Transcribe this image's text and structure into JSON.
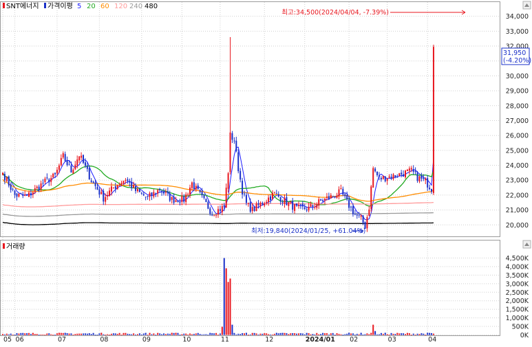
{
  "legend": {
    "title": "SNT에너지",
    "ma_label": "가격이평",
    "periods": [
      {
        "label": "5",
        "color": "#1a1aff"
      },
      {
        "label": "20",
        "color": "#22aa22"
      },
      {
        "label": "60",
        "color": "#ff8c00"
      },
      {
        "label": "120",
        "color": "#ff9999"
      },
      {
        "label": "240",
        "color": "#999999"
      },
      {
        "label": "480",
        "color": "#000000"
      }
    ]
  },
  "volume_legend": {
    "title": "거래량"
  },
  "annotations": {
    "high": "최고:34,500(2024/04/04, -7.39%)",
    "low": "최저:19,840(2024/01/25, +61.04%)",
    "last_price": "31,950",
    "last_change": "(-4.20%)"
  },
  "colors": {
    "up": "#e8161e",
    "down": "#1a30c8",
    "grid": "#cfcfcf",
    "flag": "#e8161e"
  },
  "chart_data": [
    {
      "type": "candlestick",
      "title": "SNT에너지",
      "x_tick_labels": [
        "05",
        "06",
        "07",
        "08",
        "09",
        "10",
        "11",
        "12",
        "2024/01",
        "02",
        "03",
        "04"
      ],
      "y_tick_labels": [
        "34,000",
        "33,000",
        "32,000",
        "31,000",
        "30,000",
        "29,000",
        "28,000",
        "27,000",
        "26,000",
        "25,000",
        "24,000",
        "23,000",
        "22,000",
        "21,000",
        "20,000"
      ],
      "ylim": [
        19600,
        34700
      ],
      "months": [
        {
          "label": "05",
          "bars": 6
        },
        {
          "label": "06",
          "bars": 21
        },
        {
          "label": "07",
          "bars": 21
        },
        {
          "label": "08",
          "bars": 21
        },
        {
          "label": "09",
          "bars": 20
        },
        {
          "label": "10",
          "bars": 19
        },
        {
          "label": "11",
          "bars": 22
        },
        {
          "label": "12",
          "bars": 20
        },
        {
          "label": "2024/01",
          "bars": 22
        },
        {
          "label": "02",
          "bars": 19
        },
        {
          "label": "03",
          "bars": 20
        },
        {
          "label": "04",
          "bars": 4
        }
      ],
      "price_anchors": [
        [
          0,
          23500
        ],
        [
          6,
          22000
        ],
        [
          12,
          21900
        ],
        [
          20,
          22800
        ],
        [
          26,
          23300
        ],
        [
          30,
          24600
        ],
        [
          34,
          23600
        ],
        [
          38,
          24700
        ],
        [
          44,
          23000
        ],
        [
          50,
          21800
        ],
        [
          55,
          22500
        ],
        [
          61,
          23100
        ],
        [
          66,
          22300
        ],
        [
          72,
          21800
        ],
        [
          78,
          22400
        ],
        [
          84,
          21700
        ],
        [
          90,
          21700
        ],
        [
          94,
          22800
        ],
        [
          100,
          21600
        ],
        [
          104,
          20800
        ],
        [
          110,
          21200
        ],
        [
          112,
          23600
        ],
        [
          113,
          26000
        ],
        [
          115,
          25700
        ],
        [
          117,
          23800
        ],
        [
          119,
          22300
        ],
        [
          121,
          21400
        ],
        [
          124,
          21000
        ],
        [
          128,
          21400
        ],
        [
          135,
          22100
        ],
        [
          140,
          21600
        ],
        [
          146,
          21100
        ],
        [
          152,
          21100
        ],
        [
          158,
          21600
        ],
        [
          165,
          22000
        ],
        [
          168,
          22200
        ],
        [
          171,
          21500
        ],
        [
          175,
          20700
        ],
        [
          178,
          20400
        ],
        [
          180,
          19900
        ],
        [
          182,
          21200
        ],
        [
          184,
          23800
        ],
        [
          187,
          23100
        ],
        [
          191,
          23200
        ],
        [
          195,
          23300
        ],
        [
          200,
          23500
        ],
        [
          203,
          23600
        ],
        [
          206,
          23200
        ],
        [
          210,
          22900
        ],
        [
          214,
          22300
        ],
        [
          217,
          23100
        ],
        [
          220,
          24700
        ],
        [
          223,
          24300
        ],
        [
          225,
          24200
        ],
        [
          227,
          25500
        ],
        [
          229,
          31800
        ],
        [
          230,
          32400
        ],
        [
          231,
          33350
        ],
        [
          232,
          31950
        ]
      ],
      "last_close": 31950,
      "high": {
        "value": 34500,
        "date": "2024/04/04",
        "change": "-7.39%"
      },
      "low": {
        "value": 19840,
        "date": "2024/01/25",
        "change": "+61.04%"
      },
      "moving_averages": [
        {
          "name": "5",
          "color": "#1a1aff"
        },
        {
          "name": "20",
          "color": "#22aa22"
        },
        {
          "name": "60",
          "color": "#ff8c00"
        },
        {
          "name": "120",
          "color": "#ff9999"
        },
        {
          "name": "240",
          "color": "#999999"
        },
        {
          "name": "480",
          "color": "#000000"
        }
      ]
    },
    {
      "type": "bar",
      "title": "거래량",
      "unit": "K",
      "y_tick_labels": [
        "4,500K",
        "4,000K",
        "3,500K",
        "3,000K",
        "2,500K",
        "2,000K",
        "1,500K",
        "1,000K",
        "500K",
        "0K"
      ],
      "ylim": [
        0,
        4750
      ],
      "spikes": [
        {
          "index": 109,
          "value": 480
        },
        {
          "index": 110,
          "value": 4500
        },
        {
          "index": 111,
          "value": 3900
        },
        {
          "index": 112,
          "value": 3100
        },
        {
          "index": 113,
          "value": 3300
        },
        {
          "index": 114,
          "value": 600
        },
        {
          "index": 184,
          "value": 600
        },
        {
          "index": 185,
          "value": 230
        },
        {
          "index": 227,
          "value": 240
        },
        {
          "index": 229,
          "value": 2000
        },
        {
          "index": 230,
          "value": 480
        },
        {
          "index": 231,
          "value": 300
        },
        {
          "index": 232,
          "value": 700
        }
      ]
    }
  ]
}
